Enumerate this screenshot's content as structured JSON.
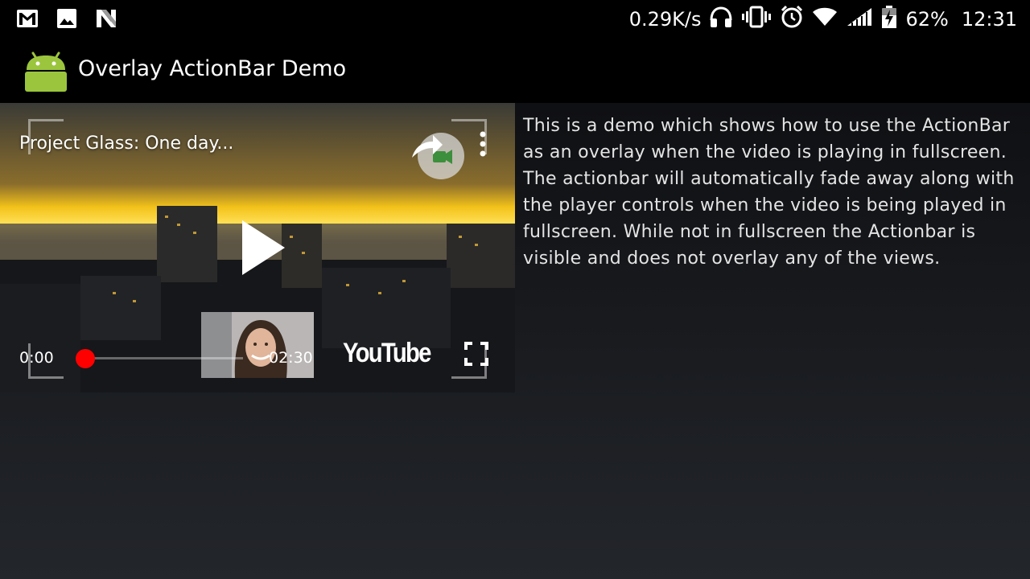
{
  "status_bar": {
    "network_speed": "0.29K/s",
    "battery_percent": "62%",
    "time": "12:31",
    "left_icons": [
      "gmail-icon",
      "gallery-icon",
      "nfc-icon"
    ],
    "right_icons": [
      "headphones-icon",
      "vibrate-icon",
      "alarm-icon",
      "wifi-icon",
      "signal-icon",
      "battery-charging-icon"
    ]
  },
  "action_bar": {
    "title": "Overlay ActionBar Demo",
    "logo_icon": "android-robot-icon",
    "logo_color": "#9bc53d"
  },
  "video_player": {
    "title": "Project Glass: One day...",
    "current_time": "0:00",
    "duration": "02:30",
    "progress_fraction": 0,
    "brand": "YouTube",
    "seek_color": "#ff0000",
    "icons": [
      "share-icon",
      "more-vert-icon",
      "play-icon",
      "fullscreen-icon"
    ]
  },
  "description": "This is a demo which shows how to use the ActionBar as an overlay when the video is playing in fullscreen. The actionbar will automatically fade away along with the player controls when the video is being played in fullscreen. While not in fullscreen the Actionbar is visible and does not overlay any of the views."
}
